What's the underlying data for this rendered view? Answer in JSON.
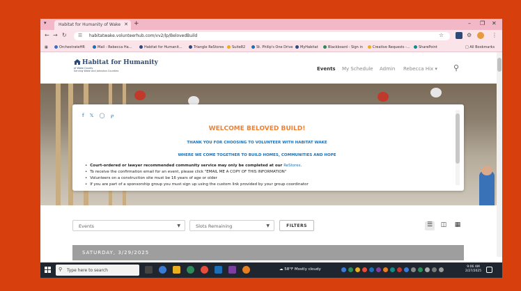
{
  "browser": {
    "tab_title": "Habitat for Humanity of Wake",
    "url": "habitatwake.volunteerhub.com/vv2/lp/BelovedBuild",
    "bookmarks": [
      "OrchestrateHR",
      "Mail - Rebecca Ha...",
      "Habitat for Humanit...",
      "Triangle ReStores",
      "Suite82",
      "St. Philip's One Drive",
      "MyHabitat",
      "Blackboard - Sign in",
      "Creative Requests -...",
      "SharePoint"
    ],
    "all_bookmarks": "All Bookmarks"
  },
  "site": {
    "logo_title": "Habitat for Humanity",
    "logo_sub1": "of Wake County",
    "logo_sub2": "Serving Wake and Johnston Counties",
    "nav": [
      "Events",
      "My Schedule",
      "Admin",
      "Rebecca Hix ▾"
    ]
  },
  "card": {
    "welcome": "WELCOME BELOVED BUILD!",
    "thanks": "THANK YOU FOR CHOOSING TO VOLUNTEER WITH HABITAT WAKE",
    "where": "WHERE WE COME TOGETHER TO BUILD HOMES, COMMUNITIES AND HOPE",
    "bullet1_bold": "Court-ordered or lawyer recommended community service may only be completed at our ",
    "bullet1_link": "ReStores",
    "bullet1_end": ".",
    "bullet2": "To receive the confirmation email for an event, please click \"EMAIL ME A COPY OF THIS INFORMATION\"",
    "bullet3": "Volunteers on a construction site must be 16 years of age or older",
    "bullet4": "If you are part of a sponsorship group you must sign up using the custom link provided by your group coordinator"
  },
  "filters": {
    "events_label": "Events",
    "slots_label": "Slots Remaining",
    "filters_button": "FILTERS"
  },
  "date_header": "SATURDAY, 3/29/2025",
  "taskbar": {
    "search_placeholder": "Type here to search",
    "weather": "58°F  Mostly cloudy",
    "time": "9:06 AM",
    "date": "2/27/2025"
  },
  "colors": {
    "frame": "#d7400c",
    "accent_orange": "#f08030",
    "accent_blue": "#1c6fb5",
    "tabbar": "#f3b8c8"
  }
}
